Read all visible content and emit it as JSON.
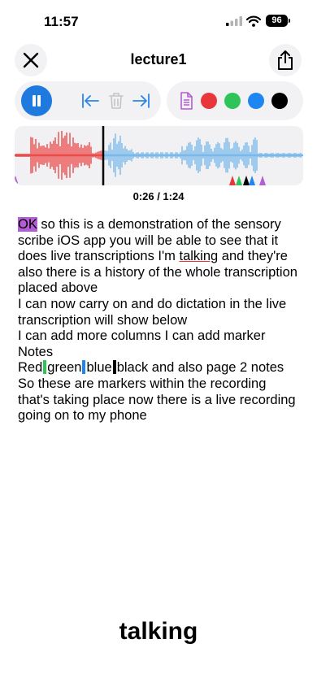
{
  "status": {
    "time": "11:57",
    "battery": "96"
  },
  "header": {
    "title": "lecture1"
  },
  "icons": {
    "close": "close-icon",
    "share": "share-icon",
    "pause": "pause-icon",
    "skip_back": "skip-to-start-icon",
    "delete": "trash-icon",
    "skip_forward": "skip-to-end-icon",
    "notes": "document-icon"
  },
  "marker_colors": {
    "red": "#e8373a",
    "green": "#2fc45a",
    "blue": "#1e86f0",
    "black": "#000000",
    "purple": "#b45dd4"
  },
  "waveform": {
    "played_color": "#ec4b4b",
    "unplayed_color": "#7ab9ea",
    "marker_triangles": [
      "#e8373a",
      "#2fc45a",
      "#000000",
      "#1e86f0",
      "#b45dd4"
    ]
  },
  "playback": {
    "time": "0:26 / 1:24"
  },
  "transcript": {
    "l1_hl": "OK",
    "l1_rest": " so this is a demonstration of the sensory",
    "l2": "scribe iOS app you will be able to see that it",
    "l3_a": "does live transcriptions I'm ",
    "l3_ul": "talking",
    "l3_b": " and they're",
    "l4": "also there is a history of the whole transcription",
    "l5": "placed above",
    "l6": "I can now carry on and do dictation in the live",
    "l7": "transcription will show below",
    "l8": "I can add more columns I can add marker",
    "l9": "Notes",
    "l10_red": "Red",
    "l10_green": "green",
    "l10_blue": "blue",
    "l10_rest": "black and also page 2 notes",
    "l11": "So these are markers within the recording",
    "l12": "that's taking place now there is a live recording",
    "l13": "going on to my phone"
  },
  "live_word": "talking"
}
